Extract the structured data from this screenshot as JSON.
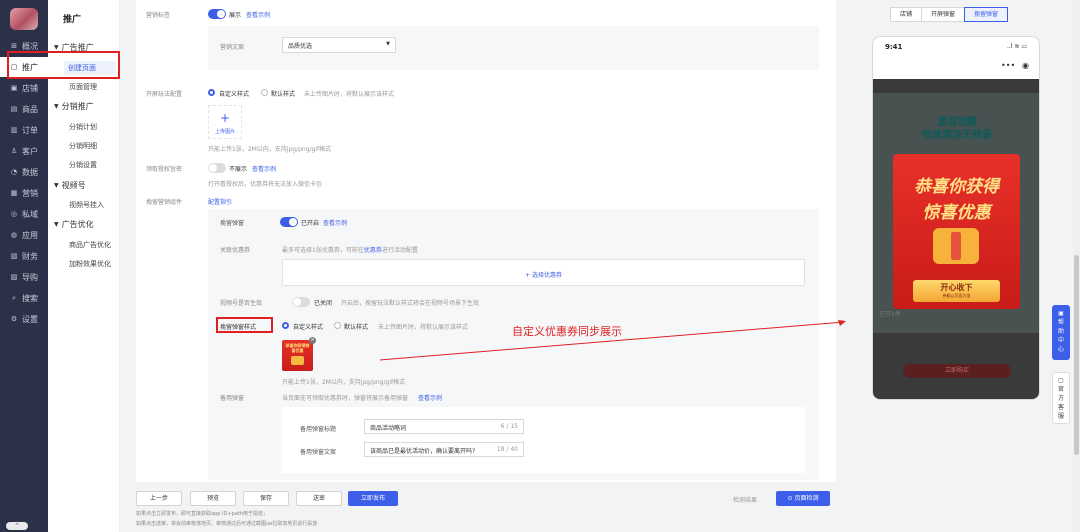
{
  "nav": {
    "items": [
      {
        "icon": "⊞",
        "label": "概况"
      },
      {
        "icon": "▢",
        "label": "推广"
      },
      {
        "icon": "▣",
        "label": "店铺"
      },
      {
        "icon": "▤",
        "label": "商品"
      },
      {
        "icon": "▥",
        "label": "订单"
      },
      {
        "icon": "♙",
        "label": "客户"
      },
      {
        "icon": "◔",
        "label": "数据"
      },
      {
        "icon": "▦",
        "label": "营销"
      },
      {
        "icon": "◎",
        "label": "私域"
      },
      {
        "icon": "◍",
        "label": "应用"
      },
      {
        "icon": "▧",
        "label": "财务"
      },
      {
        "icon": "▨",
        "label": "导购"
      },
      {
        "icon": "⌕",
        "label": "搜索"
      },
      {
        "icon": "⚙",
        "label": "设置"
      }
    ],
    "collapse": "⌃"
  },
  "subnav": {
    "title": "推广",
    "groups": [
      {
        "label": "广告推广",
        "items": [
          "创建页面",
          "页面管理"
        ]
      },
      {
        "label": "分销推广",
        "items": [
          "分销计划",
          "分销明细",
          "分销设置"
        ]
      },
      {
        "label": "视频号",
        "items": [
          "视频号挂入"
        ]
      },
      {
        "label": "广告优化",
        "items": [
          "商品广告优化",
          "加粉效果优化"
        ]
      }
    ]
  },
  "form": {
    "marketing_tag": {
      "label": "营销标签",
      "toggle_text": "展示",
      "link": "查看示例"
    },
    "marketing_copy": {
      "label": "营销文案",
      "value": "品质优选"
    },
    "open_config": {
      "label": "开屏玩法配置",
      "opt1": "自定义样式",
      "opt2": "默认样式",
      "hint": "未上传图片时，将默认展示该样式",
      "upload_label": "上传图片",
      "upload_hint": "只能上传1张，2M以内，支持jpg/png/gif格式"
    },
    "auth": {
      "label": "领取授权旨密",
      "toggle_text": "不展示",
      "link": "查看示例",
      "hint": "打开看授权后，优惠券将无法放入微信卡包"
    },
    "retain": {
      "label": "挽留营销组件",
      "link": "配置指引"
    },
    "retain_popup": {
      "label": "挽留弹窗",
      "toggle_text": "已开启",
      "link": "查看示例"
    },
    "coupon": {
      "label": "关联优惠券",
      "hint1": "最多可选择1张优惠券，可前往",
      "hint_link": "优惠券",
      "hint2": "进行活动配置",
      "add": "+ 选择优惠券"
    },
    "video_effect": {
      "label": "视频号是否生效",
      "toggle_text": "已关闭",
      "hint": "开启后，挽留玩法默认样式将会在视频号场景下生效"
    },
    "popup_style": {
      "label": "挽留弹窗样式",
      "opt1": "自定义样式",
      "opt2": "默认样式",
      "hint": "未上传图片时，将默认展示该样式",
      "thumb_text": "恭喜你获得惊喜优惠",
      "upload_hint": "只能上传1张，2M以内，支持jpg/png/gif格式"
    },
    "backup": {
      "label": "备用弹窗",
      "hint": "当页面无可领取优惠券时，弹窗将展示备用弹窗",
      "link": "查看示例",
      "title_label": "备用弹窗标题",
      "title_value": "商品活动略词",
      "title_count": "6 / 15",
      "copy_label": "备用弹窗文案",
      "copy_value": "该商品已是最优活动价，确认要离开吗?",
      "copy_count": "18 / 40"
    }
  },
  "annotation": "自定义优惠券同步展示",
  "footer": {
    "buttons": [
      "上一步",
      "预览",
      "保存",
      "送审",
      "立即发布"
    ],
    "check_label": "检测结果",
    "check_btn": "页面检测",
    "notes": [
      "如果点击立即发布，即可直接获取app ID+path用于投放；",
      "如果点击送审，将会前审核落地页，审核通过后可通过截图ue拉取落地页进行投放"
    ]
  },
  "preview": {
    "tabs": [
      "店铺",
      "开屏弹窗",
      "挽留弹窗"
    ],
    "selected_tab": 2,
    "time": "9:41",
    "status_icons": "..l ≋ ▭",
    "banner_l1": "速溶泡腾",
    "banner_l2": "快速清洁无残留",
    "popup_l1": "恭喜你获得",
    "popup_l2": "惊喜优惠",
    "popup_btn": "开心收下",
    "popup_sub": "券额以页面为准",
    "bg_text1": "立即购买",
    "bg_text2": "已开1件"
  },
  "help": {
    "h1": "帮助中心",
    "h2": "官方客服"
  },
  "colors": {
    "accent": "#3c5ee8",
    "red": "#e02020"
  }
}
